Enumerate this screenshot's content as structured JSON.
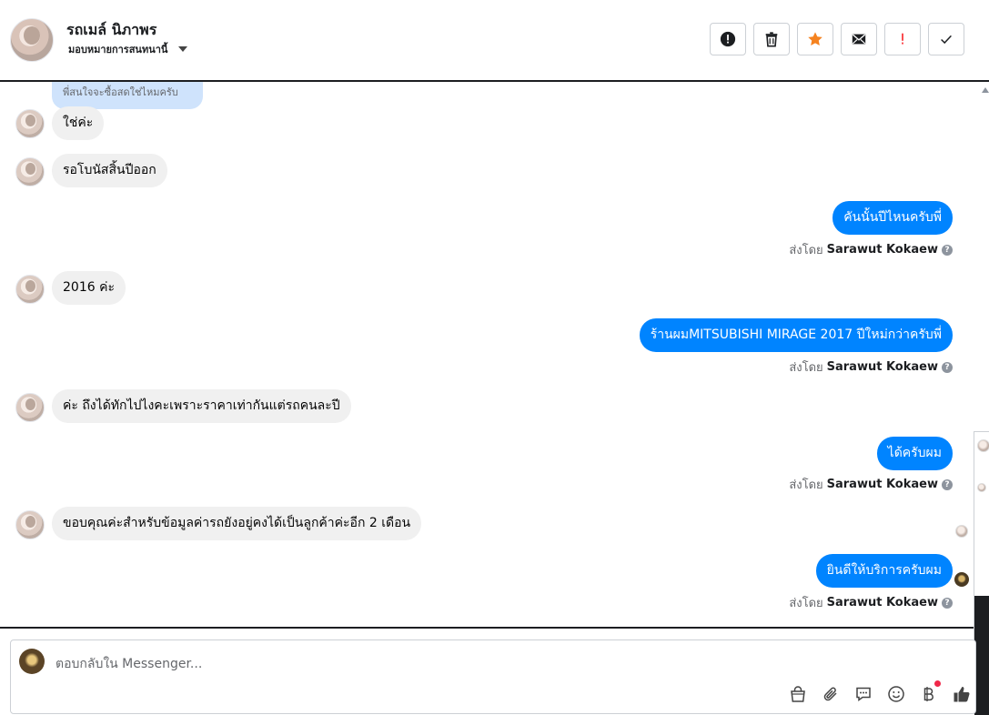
{
  "header": {
    "name": "รถเมล์ นิภาพร",
    "assign_label": "มอบหมายการสนทนานี้",
    "actions": [
      {
        "name": "report-icon",
        "color": "#1c1e21"
      },
      {
        "name": "trash-icon",
        "color": "#1c1e21"
      },
      {
        "name": "star-icon",
        "color": "#f5821f"
      },
      {
        "name": "mail-icon",
        "color": "#1c1e21"
      },
      {
        "name": "important-icon",
        "color": "#fa383e"
      },
      {
        "name": "check-icon",
        "color": "#1c1e21"
      }
    ]
  },
  "chat": {
    "quoted_reply": "พี่สนใจจะซื้อสดใช่ไหมครับ",
    "sent_by_prefix": "ส่งโดย",
    "messages": [
      {
        "dir": "in",
        "text": "ใช่ค่ะ"
      },
      {
        "dir": "in",
        "text": "รอโบนัสสิ้นปีออก"
      },
      {
        "dir": "out",
        "text": "คันนั้นปีไหนครับพี่",
        "sender": "Sarawut Kokaew"
      },
      {
        "dir": "in",
        "text": "2016 ค่ะ"
      },
      {
        "dir": "out",
        "text": "ร้านผมMITSUBISHI MIRAGE 2017 ปีใหม่กว่าครับพี่",
        "sender": "Sarawut Kokaew"
      },
      {
        "dir": "in",
        "text": "ค่ะ ถึงได้ทักไปไงคะเพราะราคาเท่ากันแต่รถคนละปี"
      },
      {
        "dir": "out",
        "text": "ได้ครับผม",
        "sender": "Sarawut Kokaew"
      },
      {
        "dir": "in",
        "text": "ขอบคุณค่ะสำหรับข้อมูลค่ารถยังอยู่คงได้เป็นลูกค้าค่ะอีก 2 เดือน"
      },
      {
        "dir": "out",
        "text": "ยินดีให้บริการครับผม",
        "sender": "Sarawut Kokaew"
      }
    ]
  },
  "composer": {
    "placeholder": "ตอบกลับใน Messenger...",
    "tools": [
      "shop-icon",
      "paperclip-icon",
      "chat-bubble-icon",
      "emoji-icon",
      "baht-icon",
      "thumbs-up-icon"
    ]
  },
  "colors": {
    "outgoing_bubble": "#0084ff",
    "incoming_bubble": "#f0f0f0",
    "quoted_bubble": "#cfe3fc"
  }
}
